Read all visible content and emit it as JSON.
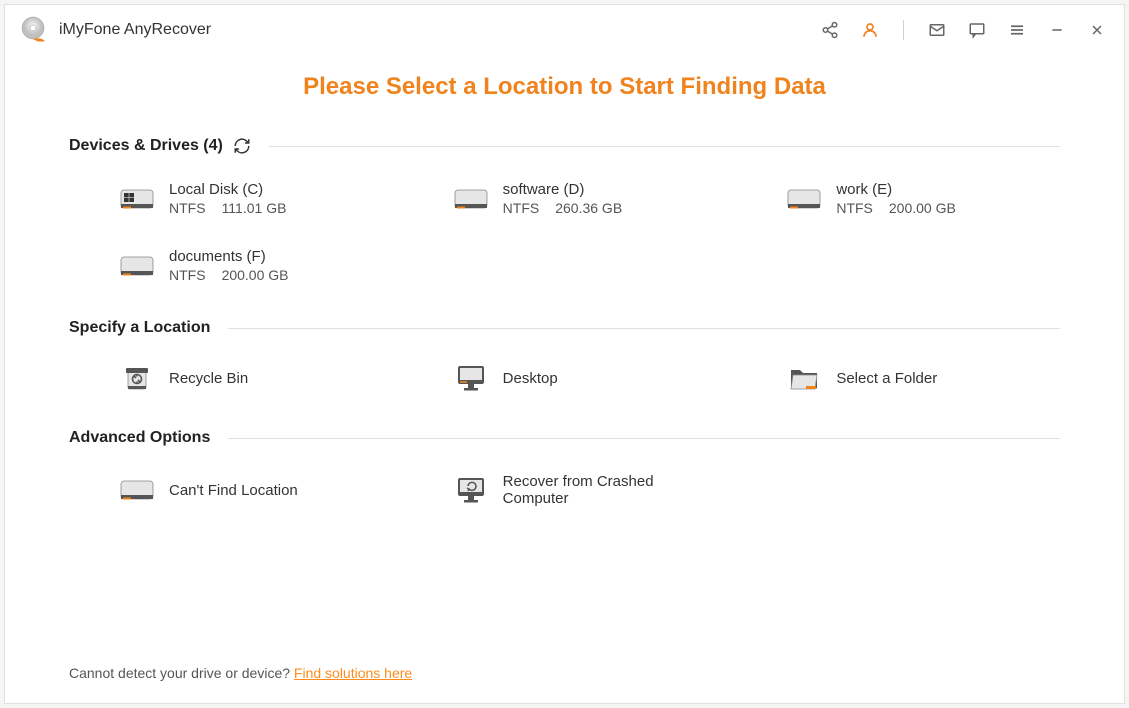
{
  "app": {
    "title": "iMyFone AnyRecover"
  },
  "main_title": "Please Select a Location to Start Finding Data",
  "sections": {
    "devices": {
      "title": "Devices & Drives (4)"
    },
    "specify": {
      "title": "Specify a Location"
    },
    "advanced": {
      "title": "Advanced Options"
    }
  },
  "drives": [
    {
      "name": "Local Disk (C)",
      "fs": "NTFS",
      "size": "111.01 GB"
    },
    {
      "name": "software (D)",
      "fs": "NTFS",
      "size": "260.36 GB"
    },
    {
      "name": "work (E)",
      "fs": "NTFS",
      "size": "200.00 GB"
    },
    {
      "name": "documents (F)",
      "fs": "NTFS",
      "size": "200.00 GB"
    }
  ],
  "locations": {
    "recycle_bin": "Recycle Bin",
    "desktop": "Desktop",
    "select_folder": "Select a Folder"
  },
  "advanced": {
    "cant_find": "Can't Find Location",
    "crashed": "Recover from Crashed Computer"
  },
  "footer": {
    "text": "Cannot detect your drive or device? ",
    "link": "Find solutions here"
  }
}
